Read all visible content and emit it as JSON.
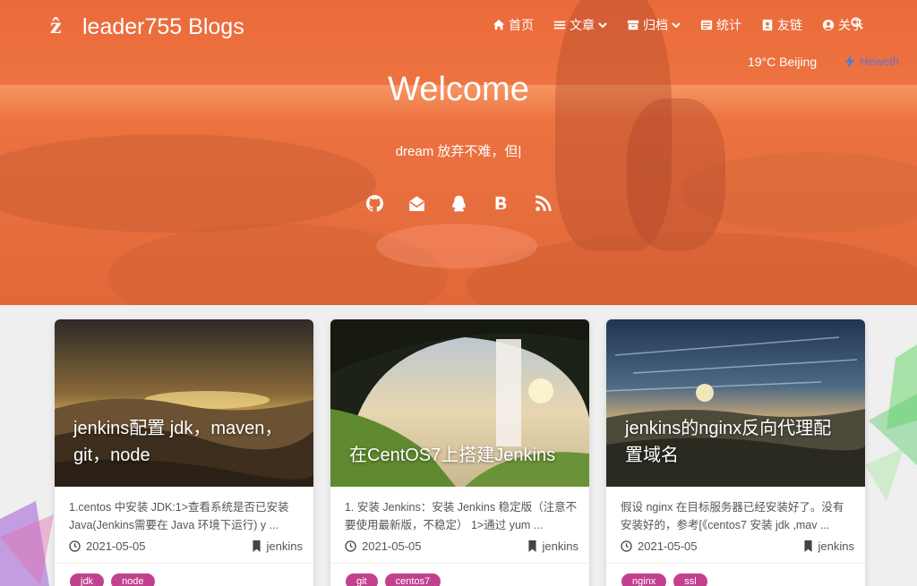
{
  "site": {
    "title": "leader755 Blogs",
    "logo": "ẑ"
  },
  "nav": [
    {
      "icon": "home-icon",
      "label": "首页",
      "dropdown": false
    },
    {
      "icon": "list-icon",
      "label": "文章",
      "dropdown": true
    },
    {
      "icon": "archive-icon",
      "label": "归档",
      "dropdown": true
    },
    {
      "icon": "chart-icon",
      "label": "统计",
      "dropdown": false
    },
    {
      "icon": "address-book-icon",
      "label": "友链",
      "dropdown": false
    },
    {
      "icon": "user-circle-icon",
      "label": "关于",
      "dropdown": false
    }
  ],
  "weather": {
    "text": "19°C  Beijing",
    "provider": "Heweth"
  },
  "hero": {
    "heading": "Welcome",
    "subtitle": "dream 放弃不难，但|",
    "socials": [
      "github-icon",
      "email-icon",
      "qq-icon",
      "bilibili-icon",
      "rss-icon"
    ]
  },
  "colors": {
    "hero": "#ee7440",
    "tag": "#c2418f",
    "accent": "#6a6fd6"
  },
  "posts": [
    {
      "title": "jenkins配置 jdk，maven，git，node",
      "excerpt": "1.centos 中安装 JDK:1>查看系统是否已安装 Java(Jenkins需要在 Java 环境下运行) y ...",
      "date": "2021-05-05",
      "category": "jenkins",
      "tags": [
        "jdk",
        "node"
      ]
    },
    {
      "title": "在CentOS7上搭建Jenkins",
      "excerpt": "1. 安装 Jenkins：安装 Jenkins 稳定版（注意不要使用最新版，不稳定） 1>通过 yum ...",
      "date": "2021-05-05",
      "category": "jenkins",
      "tags": [
        "git",
        "centos7"
      ]
    },
    {
      "title": "jenkins的nginx反向代理配置域名",
      "excerpt": "假设 nginx 在目标服务器已经安装好了。没有安装好的，参考[《centos7 安装 jdk ,mav ...",
      "date": "2021-05-05",
      "category": "jenkins",
      "tags": [
        "nginx",
        "ssl"
      ]
    }
  ]
}
